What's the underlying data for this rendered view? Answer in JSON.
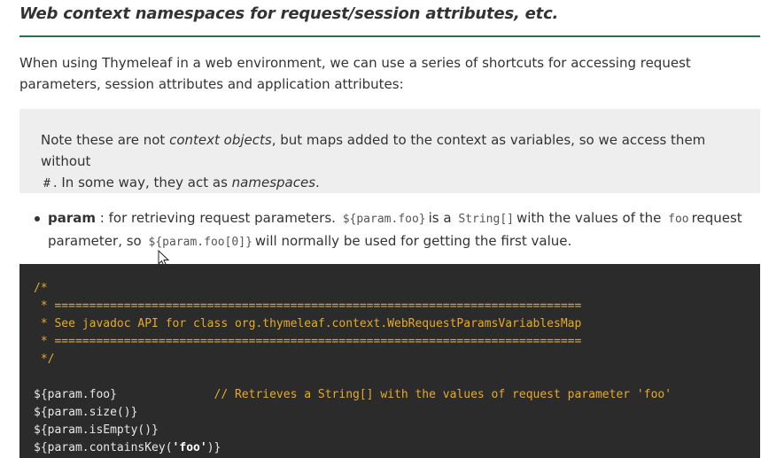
{
  "heading": "Web context namespaces for request/session attributes, etc.",
  "intro": "When using Thymeleaf in a web environment, we can use a series of shortcuts for accessing request parameters, session attributes and application attributes:",
  "note": {
    "part1": "Note these are not ",
    "em1": "context objects",
    "part2": ", but maps added to the context as variables, so we access them without",
    "hash": "#",
    "part3": ". In some way, they act as ",
    "em2": "namespaces",
    "part4": "."
  },
  "bullet": {
    "term": "param",
    "text1": " : for retrieving request parameters.",
    "code1": "${param.foo}",
    "text2": "is a",
    "code2": "String[]",
    "text3": "with the values of the",
    "code3": "foo",
    "text4": "request parameter, so",
    "code4": "${param.foo[0]}",
    "text5": "will normally be used for getting the first value."
  },
  "code": {
    "comment_lines": [
      "/*",
      " * ============================================================================",
      " * See javadoc API for class org.thymeleaf.context.WebRequestParamsVariablesMap",
      " * ============================================================================",
      " */"
    ],
    "line1_code": "${param.foo}",
    "line1_comment": "              // Retrieves a String[] with the values of request parameter 'foo'",
    "line2": "${param.size()}",
    "line3": "${param.isEmpty()}",
    "line4_a": "${param.containsKey(",
    "line4_str": "'foo'",
    "line4_b": ")}"
  },
  "colors": {
    "code_bg": "#2b2b2b",
    "code_comment": "#e6a92c",
    "heading_rule": "#2e6e4e",
    "note_bg": "#eeeeee"
  }
}
